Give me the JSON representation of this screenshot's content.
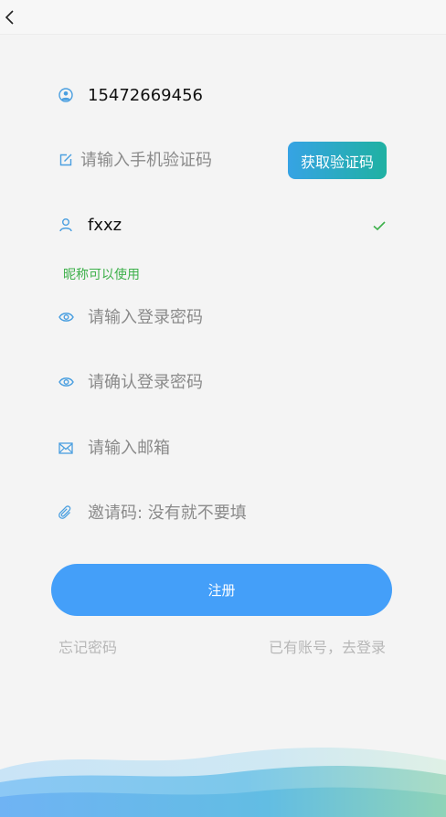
{
  "header": {
    "back_icon": "chevron-left-icon"
  },
  "form": {
    "phone": {
      "value": "15472669456",
      "icon": "user-circle-icon"
    },
    "code": {
      "placeholder": "请输入手机验证码",
      "icon": "edit-icon",
      "button_label": "获取验证码"
    },
    "nickname": {
      "value": "fxxz",
      "icon": "user-icon",
      "status_icon": "check-icon",
      "hint": "昵称可以使用"
    },
    "password": {
      "placeholder": "请输入登录密码",
      "icon": "eye-icon"
    },
    "confirm_password": {
      "placeholder": "请确认登录密码",
      "icon": "eye-icon"
    },
    "email": {
      "placeholder": "请输入邮箱",
      "icon": "mail-icon"
    },
    "invite": {
      "placeholder": "邀请码: 没有就不要填",
      "icon": "paperclip-icon"
    }
  },
  "actions": {
    "register_label": "注册",
    "forgot_label": "忘记密码",
    "login_label": "已有账号，去登录"
  },
  "colors": {
    "accent": "#449ff9",
    "icon": "#4a9fe0",
    "success": "#3db04a",
    "code_button_start": "#36a3e4",
    "code_button_end": "#1fb1a2",
    "muted_link": "#b7b7b7"
  }
}
